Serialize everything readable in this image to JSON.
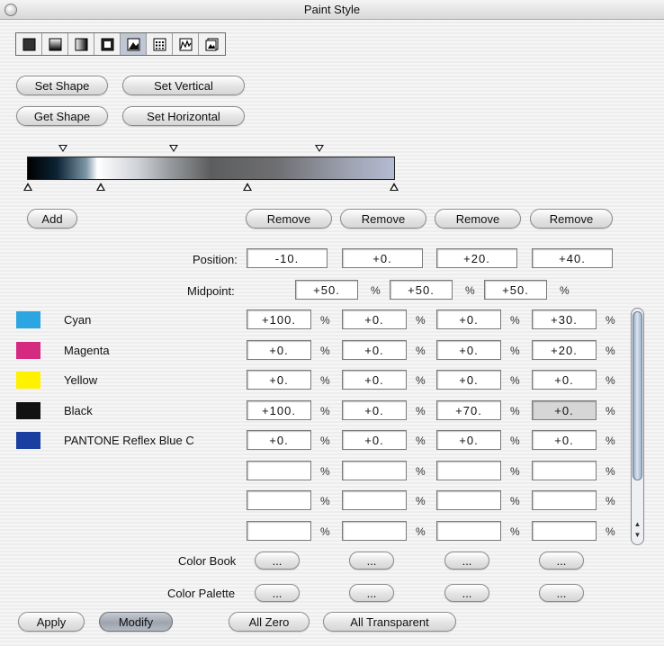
{
  "window": {
    "title": "Paint Style"
  },
  "toolbar": {
    "tools": [
      "solid-fill-icon",
      "vertical-gradient-icon",
      "horizontal-gradient-icon",
      "square-gradient-icon",
      "shape-gradient-icon",
      "pattern-grid-icon",
      "wave-chart-icon",
      "page-picture-icon"
    ],
    "active_index": 4
  },
  "shape_buttons": {
    "set_shape": "Set Shape",
    "set_vertical": "Set Vertical",
    "get_shape": "Get Shape",
    "set_horizontal": "Set Horizontal"
  },
  "gradient": {
    "add": "Add",
    "remove_labels": [
      "Remove",
      "Remove",
      "Remove",
      "Remove"
    ]
  },
  "position": {
    "label": "Position:",
    "values": [
      "-10.",
      "+0.",
      "+20.",
      "+40."
    ]
  },
  "midpoint": {
    "label": "Midpoint:",
    "values": [
      "+50.",
      "+50.",
      "+50."
    ],
    "unit": "%"
  },
  "inks": {
    "unit": "%",
    "rows": [
      {
        "name": "Cyan",
        "color": "#2ba6e0",
        "values": [
          "+100.",
          "+0.",
          "+0.",
          "+30."
        ]
      },
      {
        "name": "Magenta",
        "color": "#d42a80",
        "values": [
          "+0.",
          "+0.",
          "+0.",
          "+20."
        ]
      },
      {
        "name": "Yellow",
        "color": "#fff200",
        "values": [
          "+0.",
          "+0.",
          "+0.",
          "+0."
        ]
      },
      {
        "name": "Black",
        "color": "#111111",
        "values": [
          "+100.",
          "+0.",
          "+70.",
          "+0."
        ]
      },
      {
        "name": "PANTONE Reflex Blue C",
        "color": "#1b3fa0",
        "values": [
          "+0.",
          "+0.",
          "+0.",
          "+0."
        ]
      },
      {
        "name": "",
        "color": "",
        "values": [
          "",
          "",
          "",
          ""
        ]
      },
      {
        "name": "",
        "color": "",
        "values": [
          "",
          "",
          "",
          ""
        ]
      },
      {
        "name": "",
        "color": "",
        "values": [
          "",
          "",
          "",
          ""
        ]
      }
    ]
  },
  "color_book": {
    "label": "Color Book",
    "button": "..."
  },
  "color_palette": {
    "label": "Color Palette",
    "button": "..."
  },
  "footer": {
    "apply": "Apply",
    "modify": "Modify",
    "all_zero": "All Zero",
    "all_transparent": "All Transparent"
  }
}
